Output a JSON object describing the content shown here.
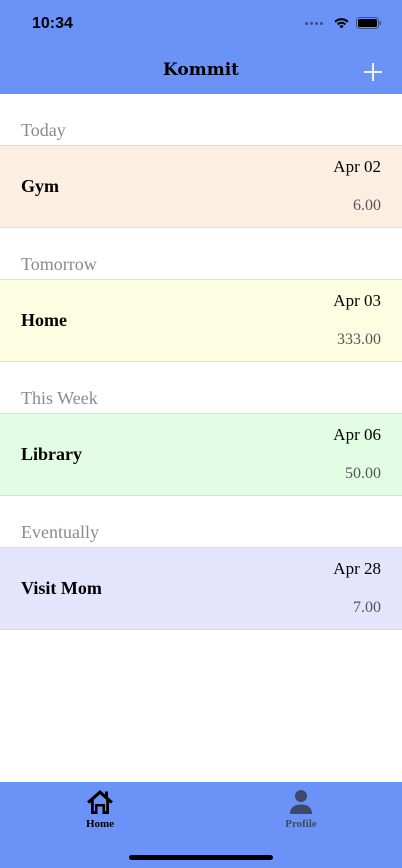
{
  "status": {
    "time": "10:34"
  },
  "nav": {
    "title": "Kommit",
    "add_icon": "plus-icon"
  },
  "sections": [
    {
      "header": "Today",
      "task": {
        "name": "Gym",
        "date": "Apr 02",
        "amount": "6.00",
        "color": "#fdeee2"
      }
    },
    {
      "header": "Tomorrow",
      "task": {
        "name": "Home",
        "date": "Apr 03",
        "amount": "333.00",
        "color": "#fefee2"
      }
    },
    {
      "header": "This Week",
      "task": {
        "name": "Library",
        "date": "Apr 06",
        "amount": "50.00",
        "color": "#e2fde4"
      }
    },
    {
      "header": "Eventually",
      "task": {
        "name": "Visit Mom",
        "date": "Apr 28",
        "amount": "7.00",
        "color": "#e4e4fd"
      }
    }
  ],
  "tabbar": {
    "tabs": [
      {
        "label": "Home",
        "icon": "home-icon",
        "color": "#000000",
        "active": true
      },
      {
        "label": "Profile",
        "icon": "person-icon",
        "color": "#3d4a66",
        "active": false
      }
    ]
  },
  "colors": {
    "accent": "#6b93f7"
  }
}
